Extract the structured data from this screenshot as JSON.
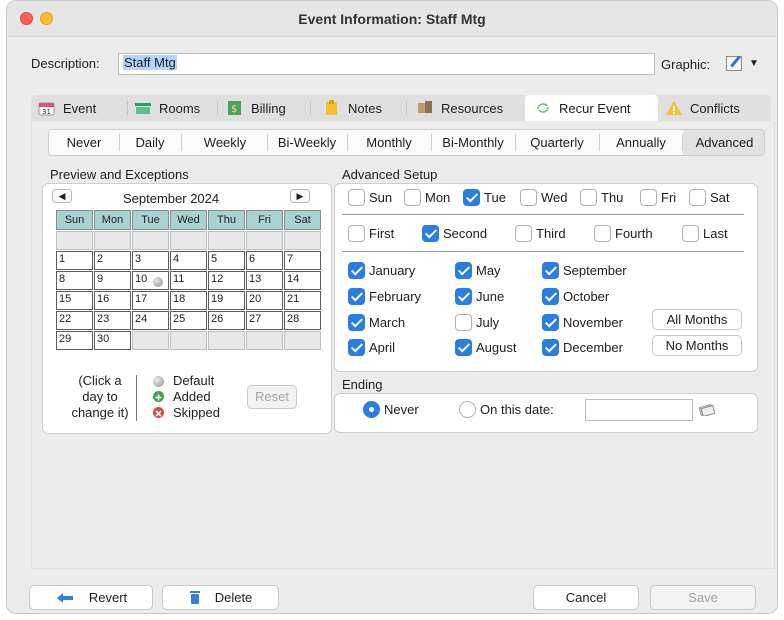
{
  "window": {
    "title": "Event Information: Staff Mtg"
  },
  "description": {
    "label": "Description:",
    "value": "Staff Mtg"
  },
  "graphic": {
    "label": "Graphic:",
    "icon": "notepad-pencil-icon",
    "dropdown": "▼"
  },
  "tabs": [
    {
      "label": "Event",
      "icon": "calendar-icon"
    },
    {
      "label": "Rooms",
      "icon": "room-icon"
    },
    {
      "label": "Billing",
      "icon": "billing-icon"
    },
    {
      "label": "Notes",
      "icon": "notes-icon"
    },
    {
      "label": "Resources",
      "icon": "resources-icon"
    },
    {
      "label": "Recur Event",
      "icon": "recur-icon"
    },
    {
      "label": "Conflicts",
      "icon": "warning-icon"
    }
  ],
  "subtabs": [
    "Never",
    "Daily",
    "Weekly",
    "Bi-Weekly",
    "Monthly",
    "Bi-Monthly",
    "Quarterly",
    "Annually",
    "Advanced"
  ],
  "preview": {
    "title": "Preview and Exceptions",
    "month": "September 2024",
    "prev": "◀",
    "next": "▶",
    "weekdays": [
      "Sun",
      "Mon",
      "Tue",
      "Wed",
      "Thu",
      "Fri",
      "Sat"
    ],
    "help_line1": "(Click a",
    "help_line2": "day to",
    "help_line3": "change it)",
    "legend_default": "Default",
    "legend_added": "Added",
    "legend_skipped": "Skipped",
    "reset": "Reset"
  },
  "calendar_days": [
    [
      "",
      "",
      "",
      "",
      "",
      "",
      ""
    ],
    [
      "1",
      "2",
      "3",
      "4",
      "5",
      "6",
      "7"
    ],
    [
      "8",
      "9",
      "10",
      "11",
      "12",
      "13",
      "14"
    ],
    [
      "15",
      "16",
      "17",
      "18",
      "19",
      "20",
      "21"
    ],
    [
      "22",
      "23",
      "24",
      "25",
      "26",
      "27",
      "28"
    ],
    [
      "29",
      "30",
      "",
      "",
      "",
      "",
      ""
    ]
  ],
  "advanced": {
    "title": "Advanced Setup",
    "days": [
      {
        "label": "Sun",
        "checked": false
      },
      {
        "label": "Mon",
        "checked": false
      },
      {
        "label": "Tue",
        "checked": true
      },
      {
        "label": "Wed",
        "checked": false
      },
      {
        "label": "Thu",
        "checked": false
      },
      {
        "label": "Fri",
        "checked": false
      },
      {
        "label": "Sat",
        "checked": false
      }
    ],
    "weeks": [
      {
        "label": "First",
        "checked": false
      },
      {
        "label": "Second",
        "checked": true
      },
      {
        "label": "Third",
        "checked": false
      },
      {
        "label": "Fourth",
        "checked": false
      },
      {
        "label": "Last",
        "checked": false
      }
    ],
    "months": [
      {
        "label": "January",
        "checked": true
      },
      {
        "label": "February",
        "checked": true
      },
      {
        "label": "March",
        "checked": true
      },
      {
        "label": "April",
        "checked": true
      },
      {
        "label": "May",
        "checked": true
      },
      {
        "label": "June",
        "checked": true
      },
      {
        "label": "July",
        "checked": false
      },
      {
        "label": "August",
        "checked": true
      },
      {
        "label": "September",
        "checked": true
      },
      {
        "label": "October",
        "checked": true
      },
      {
        "label": "November",
        "checked": true
      },
      {
        "label": "December",
        "checked": true
      }
    ],
    "all_months": "All Months",
    "no_months": "No Months"
  },
  "ending": {
    "title": "Ending",
    "never": "Never",
    "on_date": "On this date:",
    "selected": "never",
    "date_value": ""
  },
  "footer": {
    "revert": "Revert",
    "delete": "Delete",
    "cancel": "Cancel",
    "save": "Save"
  },
  "colors": {
    "accent": "#2a7de1",
    "calendar_header": "#a9d2d2",
    "selection": "#b3d4fe"
  }
}
